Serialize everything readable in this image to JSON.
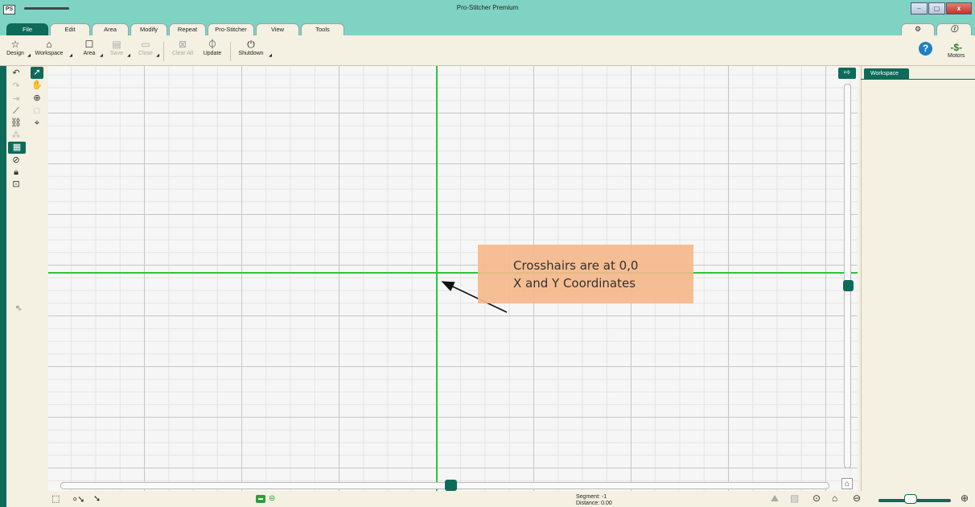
{
  "window": {
    "title": "Pro-Stitcher Premium",
    "app_icon": "PS",
    "minimize": "–",
    "maximize": "▢",
    "close": "x"
  },
  "tabs": [
    "File",
    "Edit",
    "Area",
    "Modify",
    "Repeat",
    "Pro-Stitcher",
    "View",
    "Tools"
  ],
  "active_tab": "File",
  "right_tab_icons": [
    "settings-icon",
    "info-icon"
  ],
  "ribbon": {
    "design": "Design",
    "workspace": "Workspace",
    "area": "Area",
    "save": "Save",
    "close": "Close",
    "clear_all": "Clear All",
    "update": "Update",
    "shutdown": "Shutdown",
    "help": "?",
    "motors": "Motors"
  },
  "left_tools": [
    "undo-icon",
    "select-arrow-icon",
    "redo-icon",
    "pan-hand-icon",
    "fit-icon",
    "zoom-in-icon",
    "measure-icon",
    "box-icon",
    "node-edit-icon",
    "crosshair-target-icon",
    "node-icon",
    "grid-icon",
    "needle-icon",
    "lock-icon",
    "unlock-icon"
  ],
  "right_panel": {
    "tab": "Workspace"
  },
  "annotation": {
    "line1": "Crosshairs are at 0,0",
    "line2": "X and Y Coordinates"
  },
  "status": {
    "segment": "Segment: -1",
    "distance": "Distance: 0.00"
  },
  "colors": {
    "accent": "#0e6b5a",
    "titlebar": "#7fd3c3",
    "crosshair": "#2ec43b",
    "callout": "#f5b98b",
    "background": "#f4f0e2"
  }
}
